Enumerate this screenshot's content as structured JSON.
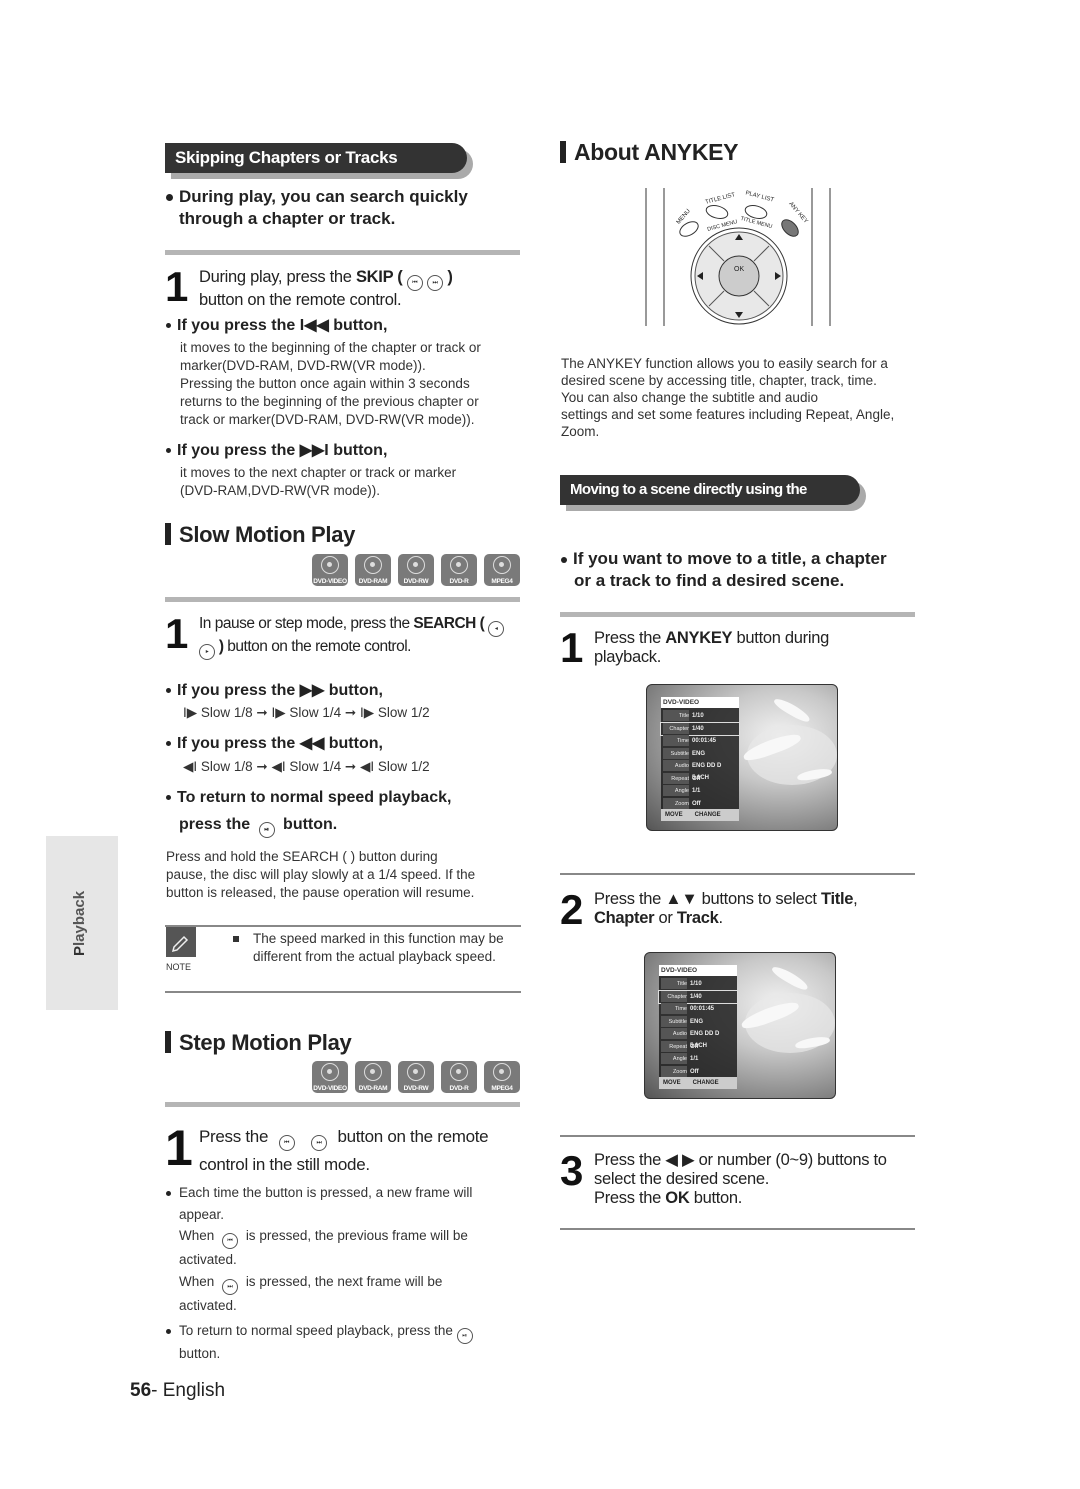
{
  "left": {
    "skip_banner": "Skipping Chapters or Tracks",
    "skip_intro": [
      "During play, you can search quickly",
      "through a chapter or track."
    ],
    "skip_step": {
      "num": "1",
      "line1_pre": "During play, press the ",
      "line1_bold": "SKIP (",
      "line1_post": ")",
      "line2": "button on the remote control."
    },
    "prev_head": "If you press the I◀◀  button,",
    "prev_body": [
      "it moves to the beginning of the chapter or track or",
      "marker(DVD-RAM, DVD-RW(VR mode)).",
      "Pressing the button once again within 3 seconds",
      "returns to the beginning of the previous chapter or",
      "track or marker(DVD-RAM, DVD-RW(VR mode))."
    ],
    "next_head": "If you press the ▶▶I  button,",
    "next_body": [
      "it moves to the next chapter or track or marker",
      "(DVD-RAM,DVD-RW(VR mode))."
    ],
    "slow_title": "Slow Motion Play",
    "disc_types": [
      "DVD-VIDEO",
      "DVD-RAM",
      "DVD-RW",
      "DVD-R",
      "MPEG4"
    ],
    "slow_step": {
      "num": "1",
      "line1_pre": "In pause or step mode, press the ",
      "line1_bold": "SEARCH (",
      "line2_bold": ")",
      "line2": " button on the remote control."
    },
    "ff_head": "If you press the ▶▶  button,",
    "ff_seq": "I▶ Slow 1/8 ➞  I▶ Slow 1/4 ➞  I▶ Slow 1/2",
    "rew_head": "If you press the ◀◀  button,",
    "rew_seq": "◀I Slow 1/8 ➞  ◀I Slow 1/4 ➞  ◀I Slow 1/2",
    "normal_head1": "To return to normal speed playback,",
    "normal_head2_pre": "press the",
    "normal_head2_post": "button.",
    "hold_text": [
      "Press and hold the SEARCH (      ) button during",
      "pause, the disc will play slowly at a 1/4 speed. If the",
      "button is released, the pause operation will resume."
    ],
    "note_label": "NOTE",
    "note_text": [
      "The speed marked in this function may be",
      "different from the actual playback speed."
    ],
    "step_title": "Step Motion Play",
    "step_step": {
      "num": "1",
      "line1_pre": "Press the",
      "line1_post": "button on the remote",
      "line2": "control in the still mode."
    },
    "step_b1": [
      "Each time the button is pressed, a new frame will",
      "appear."
    ],
    "step_b1_when1_pre": "When",
    "step_b1_when1_post": "is pressed, the previous frame will be",
    "step_b1_act": "activated.",
    "step_b1_when2_pre": "When",
    "step_b1_when2_post": "is pressed, the next frame will be",
    "step_b2_pre": "To return to normal speed playback, press the",
    "step_b2_post": "button."
  },
  "side_tab": {
    "label_first": "P",
    "label_rest": "layback"
  },
  "footer": {
    "page": "56",
    "lang": "- English"
  },
  "right": {
    "anykey_title": "About ANYKEY",
    "remote": {
      "labels": [
        "MENU",
        "TITLE LIST",
        "PLAY LIST",
        "ANY KEY",
        "DISC MENU",
        "TITLE MENU",
        "OK"
      ]
    },
    "anykey_desc": [
      "The ANYKEY function allows you to easily search for a",
      "desired scene by accessing title, chapter, track, time.",
      "You can also change the subtitle and audio",
      "settings and set some features including Repeat, Angle,",
      "Zoom."
    ],
    "moving_banner": "Moving to a scene directly using the ANYKEY",
    "moving_intro": [
      "If you want to move to a title, a chapter",
      "or a track to find a desired scene."
    ],
    "step1": {
      "num": "1",
      "pre": "Press the ",
      "bold": "ANYKEY",
      "post": " button during",
      "line2": "playback."
    },
    "osd": {
      "header": "DVD-VIDEO",
      "rows": [
        {
          "k": "Title",
          "v": "1/10"
        },
        {
          "k": "Chapter",
          "v": "1/40"
        },
        {
          "k": "Time",
          "v": "00:01:45"
        },
        {
          "k": "Subtitle",
          "v": "ENG"
        },
        {
          "k": "Audio",
          "v": "ENG DD D 5.1CH"
        },
        {
          "k": "Repeat",
          "v": "Off"
        },
        {
          "k": "Angle",
          "v": "1/1"
        },
        {
          "k": "Zoom",
          "v": "Off"
        }
      ],
      "footer_move": "MOVE",
      "footer_change": "CHANGE"
    },
    "step2": {
      "num": "2",
      "pre": "Press the ▲▼ buttons to select ",
      "b1": "Title",
      "c": ",",
      "b2": "Chapter",
      "or": " or ",
      "b3": "Track",
      "end": "."
    },
    "step3": {
      "num": "3",
      "line1": "Press the ◀ ▶ or number (0~9) buttons to",
      "line2": "select the desired scene.",
      "line3_pre": "Press the ",
      "line3_bold": "OK",
      "line3_post": " button."
    }
  }
}
